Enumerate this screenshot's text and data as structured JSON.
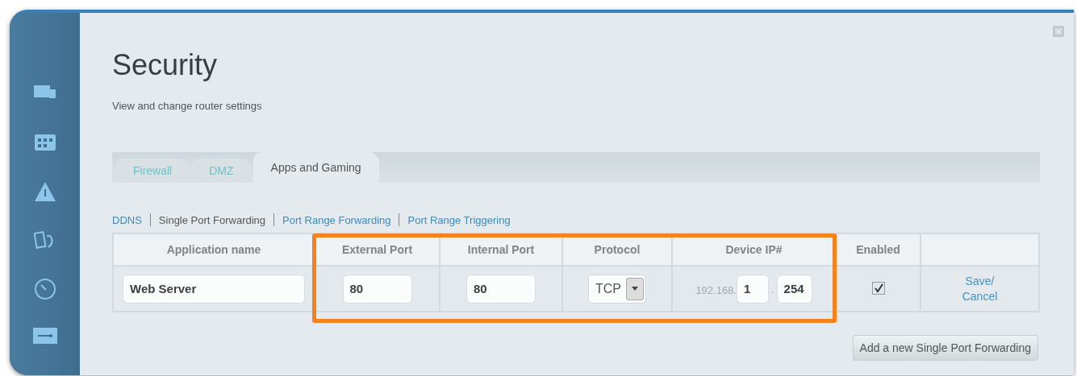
{
  "page": {
    "title": "Security",
    "subtitle": "View and change router settings"
  },
  "tabs": [
    {
      "label": "Firewall",
      "selected": false
    },
    {
      "label": "DMZ",
      "selected": false
    },
    {
      "label": "Apps and Gaming",
      "selected": true
    }
  ],
  "subnav": [
    {
      "label": "DDNS",
      "selected": false
    },
    {
      "label": "Single Port Forwarding",
      "selected": true
    },
    {
      "label": "Port Range Forwarding",
      "selected": false
    },
    {
      "label": "Port Range Triggering",
      "selected": false
    }
  ],
  "table": {
    "columns": [
      "Application name",
      "External Port",
      "Internal Port",
      "Protocol",
      "Device IP#",
      "Enabled"
    ],
    "rows": [
      {
        "application_name": "Web Server",
        "external_port": "80",
        "internal_port": "80",
        "protocol": "TCP",
        "device_ip_prefix": "192.168.",
        "device_ip_octet_3": "1",
        "device_ip_separator": ".",
        "device_ip_octet_4": "254",
        "enabled": true,
        "action": "Save/ Cancel"
      }
    ]
  },
  "add_button": "Add a new Single Port Forwarding"
}
